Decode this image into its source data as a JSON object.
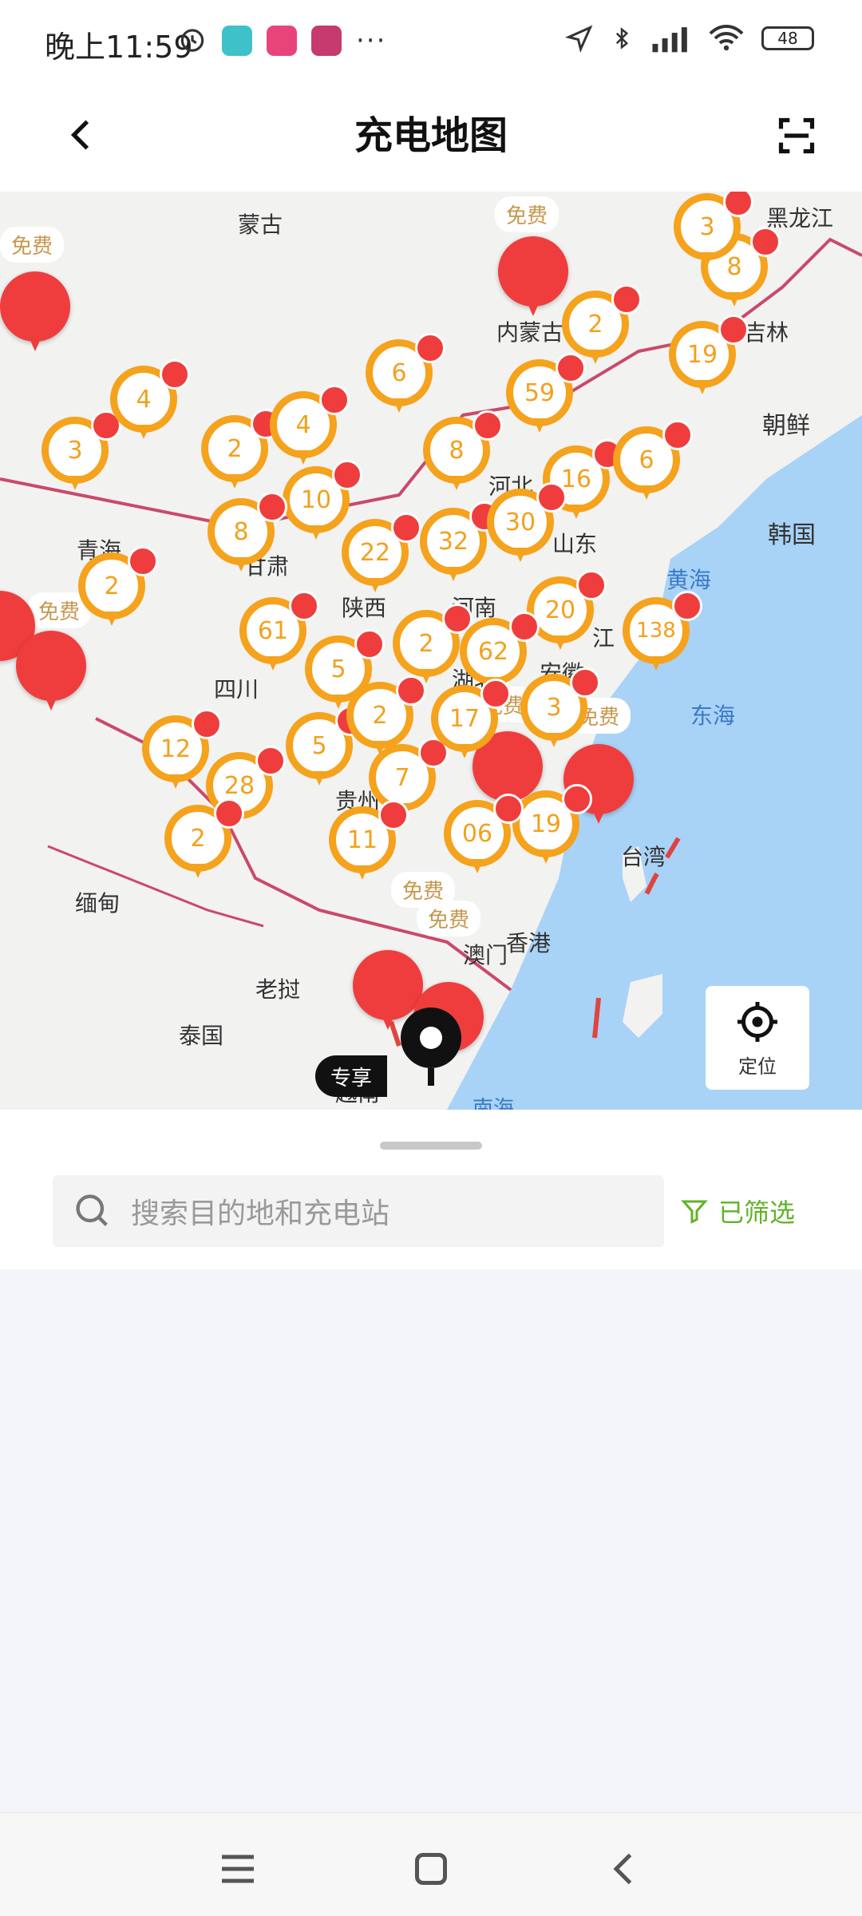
{
  "status_bar": {
    "time": "晚上11:59",
    "battery": "48"
  },
  "header": {
    "title": "充电地图"
  },
  "map": {
    "region_labels": [
      "蒙古",
      "内蒙古",
      "吉林",
      "黑龙江",
      "朝鲜",
      "韩国",
      "黄海",
      "东海",
      "青海",
      "甘肃",
      "陕西",
      "河南",
      "山东",
      "河北",
      "江",
      "安徽",
      "四川",
      "贵州",
      "湖北",
      "缅甸",
      "老挝",
      "泰国",
      "越南",
      "台湾",
      "香港",
      "澳门",
      "南海"
    ],
    "free_label": "免费",
    "exclusive_label": "专享",
    "cluster_counts": [
      "6",
      "59",
      "2",
      "8",
      "19",
      "3",
      "4",
      "2",
      "4",
      "8",
      "16",
      "6",
      "10",
      "8",
      "22",
      "32",
      "30",
      "2",
      "20",
      "138",
      "61",
      "5",
      "2",
      "62",
      "3",
      "12",
      "28",
      "5",
      "7",
      "2",
      "11",
      "19",
      "2",
      "3",
      "17",
      "06"
    ],
    "locate_label": "定位"
  },
  "search": {
    "placeholder": "搜索目的地和充电站"
  },
  "filter": {
    "label": "已筛选"
  },
  "colors": {
    "cluster": "#f5a21d",
    "station_red": "#ef3d3d",
    "filter_green": "#61b327",
    "water": "#a9d2f7"
  }
}
